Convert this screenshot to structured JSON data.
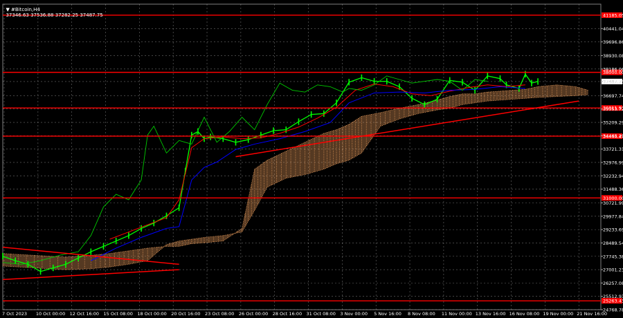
{
  "header": {
    "symbol": "▼ #Bitcoin,H4",
    "ohlc": "37346.63 37536.88 37282.25 37487.75"
  },
  "colors": {
    "background": "#000000",
    "grid": "#c8c8c8",
    "axis_text": "#ffffff",
    "price": "#00ff00",
    "tenkan": "#ff0000",
    "kijun": "#0000ff",
    "chikou": "#00cc00",
    "cloud": "#f4a460",
    "levels": "#ff0000",
    "trendlines": "#ff0000",
    "current_price_bg": "#ffffff"
  },
  "chart_data": {
    "type": "line",
    "title": "#Bitcoin,H4",
    "ylim": [
      24768.78,
      41800
    ],
    "grid": true,
    "x_ticks": [
      "7 Oct 2023",
      "10 Oct 00:00",
      "12 Oct 16:00",
      "15 Oct 08:00",
      "18 Oct 00:00",
      "20 Oct 16:00",
      "23 Oct 08:00",
      "26 Oct 00:00",
      "28 Oct 16:00",
      "31 Oct 08:00",
      "3 Nov 00:00",
      "5 Nov 16:00",
      "8 Nov 08:00",
      "11 Nov 00:00",
      "13 Nov 16:00",
      "16 Nov 08:00",
      "19 Nov 00:00",
      "21 Nov 16:00"
    ],
    "y_ticks": [
      "40441.04",
      "39696.86",
      "38930.08",
      "38186.06",
      "37487.75",
      "36697.74",
      "35953.72",
      "35209.29",
      "34465.29",
      "33721.31",
      "32976.99",
      "32232.94",
      "31488.36",
      "30721.99",
      "29977.84",
      "29233.69",
      "28489.54",
      "27745.38",
      "27001.23",
      "26257.08",
      "25512.93",
      "24768.78"
    ],
    "current_price": 37487.75,
    "horizontal_levels": [
      {
        "value": 41185.05,
        "label": "41185.05"
      },
      {
        "value": 38000.0,
        "label": "38000.00"
      },
      {
        "value": 36011.93,
        "label": "36011.93"
      },
      {
        "value": 34444.47,
        "label": "34444.47"
      },
      {
        "value": 31000.0,
        "label": "31000.00"
      },
      {
        "value": 25263.43,
        "label": "25263.43"
      }
    ],
    "trendlines": [
      {
        "x": [
          0,
          56
        ],
        "y": [
          28250,
          27300
        ]
      },
      {
        "x": [
          0,
          56
        ],
        "y": [
          26450,
          27000
        ]
      },
      {
        "x": [
          74,
          183
        ],
        "y": [
          33300,
          36400
        ]
      }
    ],
    "series": [
      {
        "name": "Price",
        "x": [
          0,
          4,
          8,
          12,
          16,
          20,
          24,
          28,
          32,
          36,
          40,
          44,
          48,
          52,
          56,
          58,
          60,
          62,
          64,
          66,
          70,
          74,
          78,
          82,
          86,
          90,
          94,
          98,
          102,
          106,
          110,
          114,
          118,
          122,
          126,
          130,
          134,
          138,
          142,
          146,
          150,
          154,
          158,
          160,
          164,
          166,
          168,
          170
        ],
        "values": [
          27750,
          27500,
          27300,
          26900,
          27100,
          27300,
          27650,
          28000,
          28300,
          28600,
          28900,
          29300,
          29600,
          30000,
          30450,
          32500,
          34500,
          34700,
          34300,
          34400,
          34300,
          34100,
          34250,
          34500,
          34750,
          34800,
          35250,
          35650,
          35700,
          36300,
          37450,
          37700,
          37500,
          37500,
          37200,
          36550,
          36200,
          36500,
          37550,
          37450,
          37000,
          37800,
          37650,
          37300,
          37100,
          37900,
          37400,
          37487.75
        ]
      },
      {
        "name": "Tenkan-sen",
        "x": [
          34,
          40,
          46,
          52,
          56,
          60,
          64,
          70,
          76,
          82,
          88,
          94,
          100,
          106,
          112,
          118,
          124,
          130,
          136,
          142,
          148,
          154,
          160,
          166
        ],
        "values": [
          28700,
          29100,
          29500,
          29900,
          30900,
          33800,
          34300,
          34400,
          34300,
          34350,
          34600,
          34950,
          35450,
          36050,
          37000,
          37350,
          37200,
          36800,
          36700,
          36950,
          37150,
          37300,
          37200,
          37300
        ]
      },
      {
        "name": "Kijun-sen",
        "x": [
          28,
          36,
          44,
          52,
          56,
          60,
          64,
          68,
          74,
          80,
          88,
          96,
          104,
          110,
          118,
          126,
          134,
          142,
          150,
          158,
          166
        ],
        "values": [
          27500,
          28200,
          28800,
          29300,
          29400,
          32000,
          32700,
          33000,
          33700,
          34000,
          34300,
          34700,
          35200,
          36300,
          36850,
          36900,
          36850,
          37000,
          37050,
          37200,
          37100
        ]
      },
      {
        "name": "Chikou span",
        "x": [
          0,
          6,
          12,
          18,
          24,
          28,
          32,
          36,
          40,
          44,
          46,
          48,
          52,
          56,
          60,
          64,
          68,
          72,
          76,
          80,
          84,
          88,
          92,
          96,
          100,
          104,
          108,
          110,
          114,
          118,
          122,
          126,
          130,
          134,
          138,
          142,
          146,
          150,
          154
        ],
        "values": [
          27400,
          27300,
          27500,
          27800,
          28000,
          28900,
          30500,
          31200,
          30900,
          32000,
          34500,
          35000,
          33500,
          34200,
          34000,
          35500,
          34100,
          34700,
          35500,
          34800,
          36200,
          37400,
          37000,
          36900,
          37300,
          37200,
          36900,
          37100,
          37000,
          37300,
          37800,
          37600,
          37400,
          37500,
          37600,
          37500,
          37000,
          37600,
          37500
        ]
      }
    ],
    "cloud": {
      "x": [
        0,
        10,
        20,
        28,
        34,
        40,
        46,
        52,
        56,
        60,
        64,
        70,
        76,
        80,
        84,
        90,
        96,
        102,
        106,
        110,
        114,
        120,
        126,
        132,
        138,
        142,
        146,
        150,
        154,
        158,
        162,
        166,
        170,
        176,
        182,
        186
      ],
      "upper": [
        27900,
        27800,
        27700,
        27800,
        27900,
        28050,
        28200,
        28300,
        28300,
        28450,
        28500,
        28600,
        29300,
        32600,
        33100,
        33600,
        34100,
        34600,
        34800,
        35100,
        35550,
        35750,
        36000,
        36200,
        36450,
        36650,
        36800,
        36800,
        36900,
        36950,
        37000,
        37050,
        37200,
        37300,
        37200,
        37000
      ],
      "lower": [
        27200,
        27100,
        27000,
        27050,
        27150,
        27300,
        27500,
        28400,
        28600,
        28700,
        28800,
        28900,
        29100,
        30300,
        31600,
        32100,
        32300,
        32600,
        32900,
        33100,
        33500,
        35000,
        35400,
        35700,
        35900,
        36000,
        36200,
        36300,
        36400,
        36450,
        36500,
        36550,
        36600,
        36650,
        36700,
        36750
      ]
    }
  }
}
